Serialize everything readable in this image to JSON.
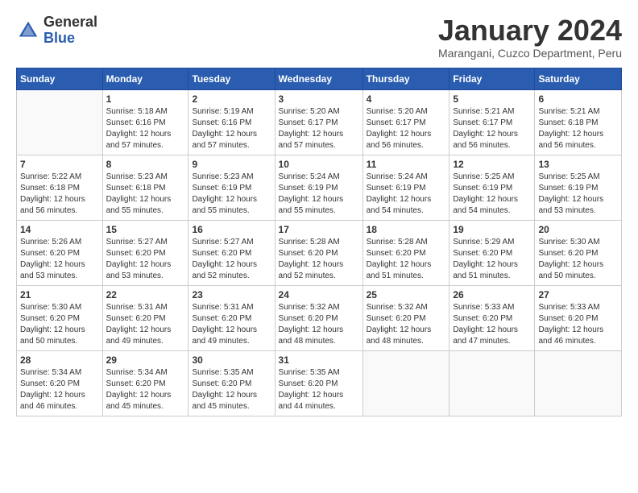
{
  "logo": {
    "general": "General",
    "blue": "Blue"
  },
  "title": "January 2024",
  "location": "Marangani, Cuzco Department, Peru",
  "days_of_week": [
    "Sunday",
    "Monday",
    "Tuesday",
    "Wednesday",
    "Thursday",
    "Friday",
    "Saturday"
  ],
  "weeks": [
    [
      {
        "day": "",
        "info": ""
      },
      {
        "day": "1",
        "info": "Sunrise: 5:18 AM\nSunset: 6:16 PM\nDaylight: 12 hours\nand 57 minutes."
      },
      {
        "day": "2",
        "info": "Sunrise: 5:19 AM\nSunset: 6:16 PM\nDaylight: 12 hours\nand 57 minutes."
      },
      {
        "day": "3",
        "info": "Sunrise: 5:20 AM\nSunset: 6:17 PM\nDaylight: 12 hours\nand 57 minutes."
      },
      {
        "day": "4",
        "info": "Sunrise: 5:20 AM\nSunset: 6:17 PM\nDaylight: 12 hours\nand 56 minutes."
      },
      {
        "day": "5",
        "info": "Sunrise: 5:21 AM\nSunset: 6:17 PM\nDaylight: 12 hours\nand 56 minutes."
      },
      {
        "day": "6",
        "info": "Sunrise: 5:21 AM\nSunset: 6:18 PM\nDaylight: 12 hours\nand 56 minutes."
      }
    ],
    [
      {
        "day": "7",
        "info": "Sunrise: 5:22 AM\nSunset: 6:18 PM\nDaylight: 12 hours\nand 56 minutes."
      },
      {
        "day": "8",
        "info": "Sunrise: 5:23 AM\nSunset: 6:18 PM\nDaylight: 12 hours\nand 55 minutes."
      },
      {
        "day": "9",
        "info": "Sunrise: 5:23 AM\nSunset: 6:19 PM\nDaylight: 12 hours\nand 55 minutes."
      },
      {
        "day": "10",
        "info": "Sunrise: 5:24 AM\nSunset: 6:19 PM\nDaylight: 12 hours\nand 55 minutes."
      },
      {
        "day": "11",
        "info": "Sunrise: 5:24 AM\nSunset: 6:19 PM\nDaylight: 12 hours\nand 54 minutes."
      },
      {
        "day": "12",
        "info": "Sunrise: 5:25 AM\nSunset: 6:19 PM\nDaylight: 12 hours\nand 54 minutes."
      },
      {
        "day": "13",
        "info": "Sunrise: 5:25 AM\nSunset: 6:19 PM\nDaylight: 12 hours\nand 53 minutes."
      }
    ],
    [
      {
        "day": "14",
        "info": "Sunrise: 5:26 AM\nSunset: 6:20 PM\nDaylight: 12 hours\nand 53 minutes."
      },
      {
        "day": "15",
        "info": "Sunrise: 5:27 AM\nSunset: 6:20 PM\nDaylight: 12 hours\nand 53 minutes."
      },
      {
        "day": "16",
        "info": "Sunrise: 5:27 AM\nSunset: 6:20 PM\nDaylight: 12 hours\nand 52 minutes."
      },
      {
        "day": "17",
        "info": "Sunrise: 5:28 AM\nSunset: 6:20 PM\nDaylight: 12 hours\nand 52 minutes."
      },
      {
        "day": "18",
        "info": "Sunrise: 5:28 AM\nSunset: 6:20 PM\nDaylight: 12 hours\nand 51 minutes."
      },
      {
        "day": "19",
        "info": "Sunrise: 5:29 AM\nSunset: 6:20 PM\nDaylight: 12 hours\nand 51 minutes."
      },
      {
        "day": "20",
        "info": "Sunrise: 5:30 AM\nSunset: 6:20 PM\nDaylight: 12 hours\nand 50 minutes."
      }
    ],
    [
      {
        "day": "21",
        "info": "Sunrise: 5:30 AM\nSunset: 6:20 PM\nDaylight: 12 hours\nand 50 minutes."
      },
      {
        "day": "22",
        "info": "Sunrise: 5:31 AM\nSunset: 6:20 PM\nDaylight: 12 hours\nand 49 minutes."
      },
      {
        "day": "23",
        "info": "Sunrise: 5:31 AM\nSunset: 6:20 PM\nDaylight: 12 hours\nand 49 minutes."
      },
      {
        "day": "24",
        "info": "Sunrise: 5:32 AM\nSunset: 6:20 PM\nDaylight: 12 hours\nand 48 minutes."
      },
      {
        "day": "25",
        "info": "Sunrise: 5:32 AM\nSunset: 6:20 PM\nDaylight: 12 hours\nand 48 minutes."
      },
      {
        "day": "26",
        "info": "Sunrise: 5:33 AM\nSunset: 6:20 PM\nDaylight: 12 hours\nand 47 minutes."
      },
      {
        "day": "27",
        "info": "Sunrise: 5:33 AM\nSunset: 6:20 PM\nDaylight: 12 hours\nand 46 minutes."
      }
    ],
    [
      {
        "day": "28",
        "info": "Sunrise: 5:34 AM\nSunset: 6:20 PM\nDaylight: 12 hours\nand 46 minutes."
      },
      {
        "day": "29",
        "info": "Sunrise: 5:34 AM\nSunset: 6:20 PM\nDaylight: 12 hours\nand 45 minutes."
      },
      {
        "day": "30",
        "info": "Sunrise: 5:35 AM\nSunset: 6:20 PM\nDaylight: 12 hours\nand 45 minutes."
      },
      {
        "day": "31",
        "info": "Sunrise: 5:35 AM\nSunset: 6:20 PM\nDaylight: 12 hours\nand 44 minutes."
      },
      {
        "day": "",
        "info": ""
      },
      {
        "day": "",
        "info": ""
      },
      {
        "day": "",
        "info": ""
      }
    ]
  ]
}
